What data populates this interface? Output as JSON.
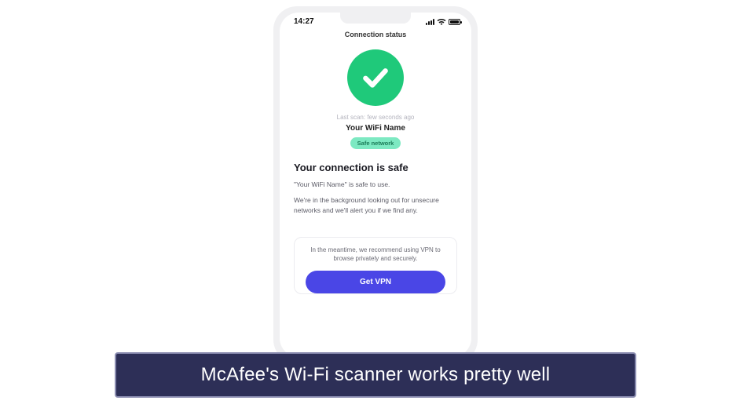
{
  "statusbar": {
    "time": "14:27"
  },
  "header": {
    "title": "Connection status"
  },
  "scan": {
    "last_scan": "Last scan: few seconds ago",
    "wifi_name": "Your WiFi Name",
    "badge": "Safe network"
  },
  "result": {
    "heading": "Your connection is safe",
    "line1": "\"Your WiFi Name\" is safe to use.",
    "line2": "We're in the background looking out for unsecure networks and we'll alert you if we find any."
  },
  "vpn": {
    "text": "In the meantime, we recommend using VPN to browse privately and securely.",
    "cta": "Get VPN"
  },
  "caption": "McAfee's Wi-Fi scanner works pretty well"
}
